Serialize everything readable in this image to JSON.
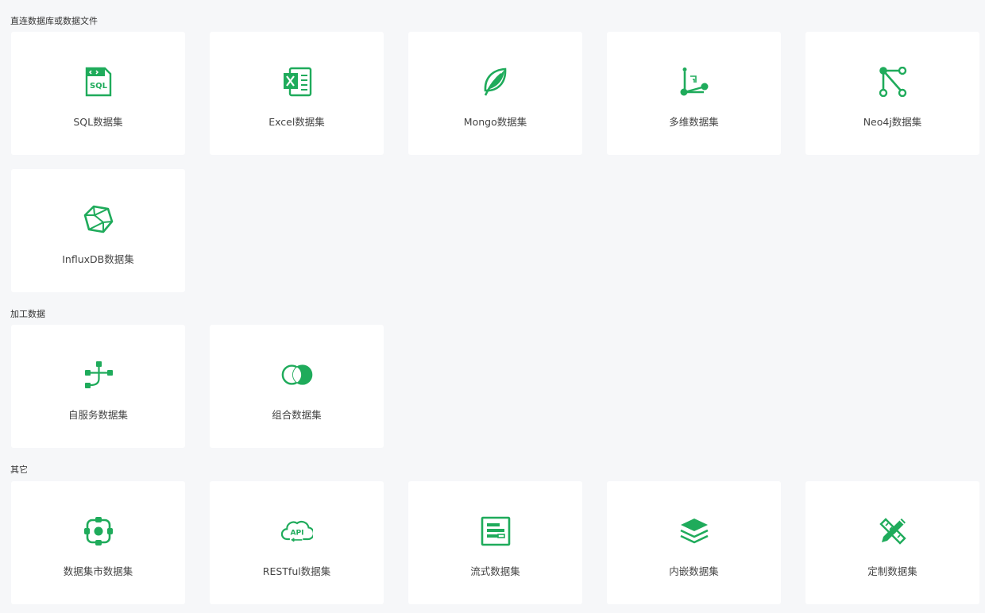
{
  "accent_color": "#1fab5b",
  "sections": [
    {
      "title": "直连数据库或数据文件",
      "cards": [
        {
          "label": "SQL数据集",
          "icon": "sql-file-icon"
        },
        {
          "label": "Excel数据集",
          "icon": "excel-icon"
        },
        {
          "label": "Mongo数据集",
          "icon": "leaf-icon"
        },
        {
          "label": "多维数据集",
          "icon": "multidimensional-icon"
        },
        {
          "label": "Neo4j数据集",
          "icon": "graph-nodes-icon"
        },
        {
          "label": "InfluxDB数据集",
          "icon": "polyhedron-icon"
        }
      ]
    },
    {
      "title": "加工数据",
      "cards": [
        {
          "label": "自服务数据集",
          "icon": "flow-tree-icon"
        },
        {
          "label": "组合数据集",
          "icon": "overlap-circles-icon"
        }
      ]
    },
    {
      "title": "其它",
      "cards": [
        {
          "label": "数据集市数据集",
          "icon": "data-mart-icon"
        },
        {
          "label": "RESTful数据集",
          "icon": "api-cloud-icon"
        },
        {
          "label": "流式数据集",
          "icon": "stream-icon"
        },
        {
          "label": "内嵌数据集",
          "icon": "layers-icon"
        },
        {
          "label": "定制数据集",
          "icon": "ruler-pencil-icon"
        }
      ]
    }
  ]
}
